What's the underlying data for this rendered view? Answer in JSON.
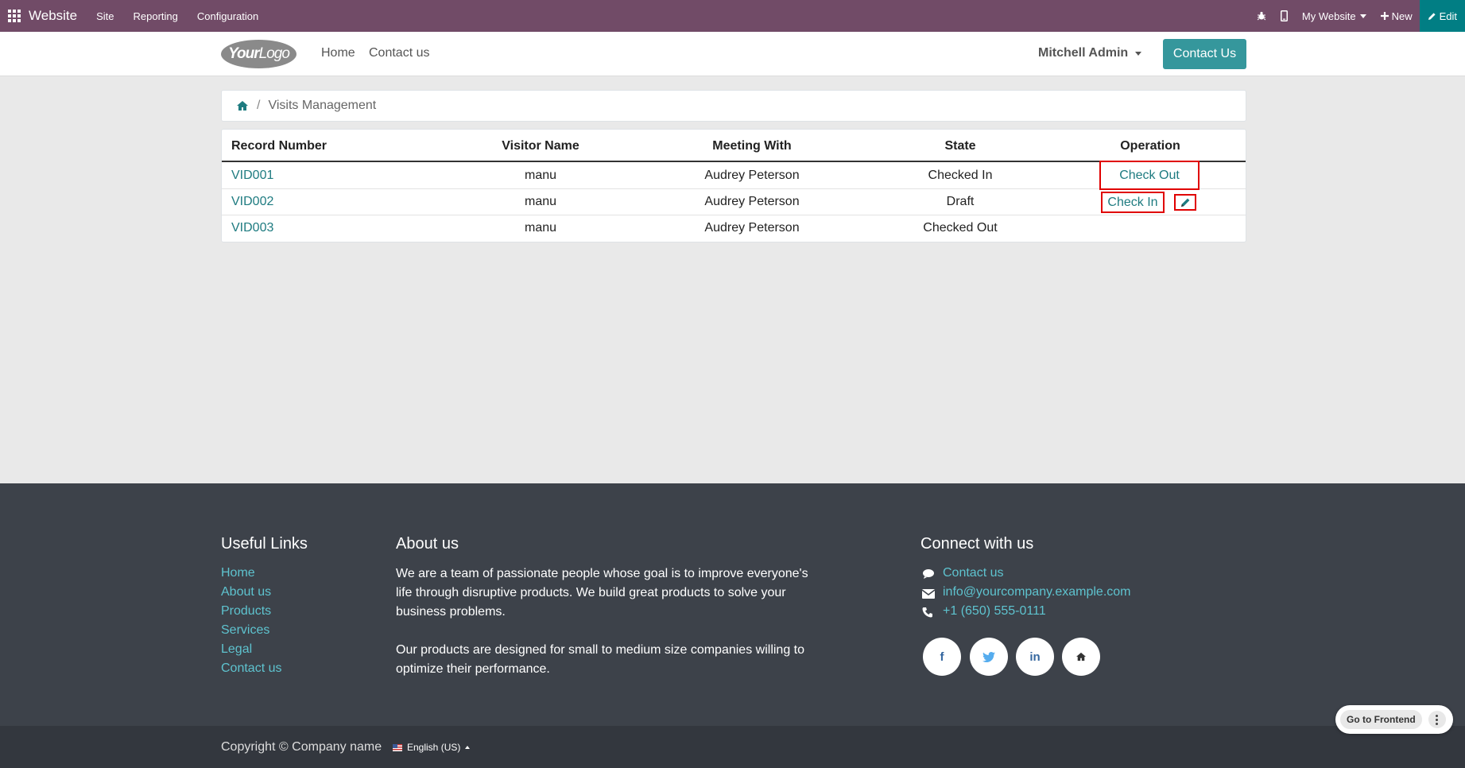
{
  "topbar": {
    "brand": "Website",
    "menus": [
      "Site",
      "Reporting",
      "Configuration"
    ],
    "my_website": "My Website",
    "new_label": "New",
    "edit_label": "Edit"
  },
  "header": {
    "logo_text_bold": "Your",
    "logo_text": "Logo",
    "nav": [
      "Home",
      "Contact us"
    ],
    "user": "Mitchell Admin",
    "contact_button": "Contact Us"
  },
  "breadcrumb": {
    "separator": "/",
    "current": "Visits Management"
  },
  "table": {
    "headers": [
      "Record Number",
      "Visitor Name",
      "Meeting With",
      "State",
      "Operation"
    ],
    "rows": [
      {
        "record": "VID001",
        "visitor": "manu",
        "meeting": "Audrey Peterson",
        "state": "Checked In",
        "operation": "Check Out"
      },
      {
        "record": "VID002",
        "visitor": "manu",
        "meeting": "Audrey Peterson",
        "state": "Draft",
        "operation": "Check In"
      },
      {
        "record": "VID003",
        "visitor": "manu",
        "meeting": "Audrey Peterson",
        "state": "Checked Out",
        "operation": ""
      }
    ]
  },
  "footer": {
    "useful_links_title": "Useful Links",
    "useful_links": [
      "Home",
      "About us",
      "Products",
      "Services",
      "Legal",
      "Contact us"
    ],
    "about_title": "About us",
    "about_p1": "We are a team of passionate people whose goal is to improve everyone's life through disruptive products. We build great products to solve your business problems.",
    "about_p2": "Our products are designed for small to medium size companies willing to optimize their performance.",
    "connect_title": "Connect with us",
    "contact_link": "Contact us",
    "email": "info@yourcompany.example.com",
    "phone": "+1 (650) 555-0111",
    "social_facebook": "f",
    "social_linkedin": "in"
  },
  "copyright": {
    "text": "Copyright © Company name",
    "language": "English (US)"
  },
  "frontend_button": "Go to Frontend",
  "colors": {
    "topbar": "#714b67",
    "accent": "#35979c",
    "link": "#1e7b80",
    "highlight": "#e00000",
    "footer": "#3d424a"
  }
}
